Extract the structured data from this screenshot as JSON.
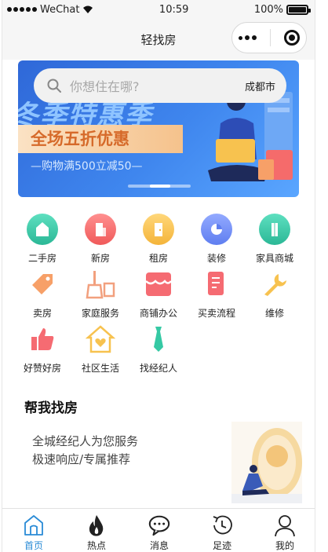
{
  "status_bar": {
    "carrier": "WeChat",
    "time": "10:59",
    "battery": "100%"
  },
  "nav": {
    "title": "轻找房"
  },
  "search": {
    "placeholder": "你想住在哪?",
    "city": "成都市"
  },
  "banner": {
    "headline": "冬季特惠季",
    "promo": "全场五折优惠",
    "sub": "—购物满500立减50—"
  },
  "menu": {
    "rows": [
      [
        {
          "label": "二手房",
          "icon": "house-icon",
          "color": "#3ac9a8"
        },
        {
          "label": "新房",
          "icon": "building-icon",
          "color": "#f56b6b"
        },
        {
          "label": "租房",
          "icon": "door-icon",
          "color": "#f7c24f"
        },
        {
          "label": "装修",
          "icon": "pie-icon",
          "color": "#6f8cf2"
        },
        {
          "label": "家具商城",
          "icon": "furniture-icon",
          "color": "#35c9a4"
        }
      ],
      [
        {
          "label": "卖房",
          "icon": "tag-icon",
          "color": "#f7a068"
        },
        {
          "label": "家庭服务",
          "icon": "broom-icon",
          "color": "#f2a07e"
        },
        {
          "label": "商铺办公",
          "icon": "shop-icon",
          "color": "#f56b72"
        },
        {
          "label": "买卖流程",
          "icon": "document-icon",
          "color": "#f56b72"
        },
        {
          "label": "维修",
          "icon": "wrench-icon",
          "color": "#f7c24f"
        }
      ],
      [
        {
          "label": "好赞好房",
          "icon": "thumbs-up-icon",
          "color": "#f56b72"
        },
        {
          "label": "社区生活",
          "icon": "home-heart-icon",
          "color": "#f7c24f"
        },
        {
          "label": "找经纪人",
          "icon": "tie-icon",
          "color": "#35c9a4"
        }
      ]
    ]
  },
  "help": {
    "title": "帮我找房",
    "line1": "全城经纪人为您服务",
    "line2": "极速响应/专属推荐"
  },
  "tabbar": {
    "items": [
      {
        "label": "首页",
        "icon": "home-icon",
        "active": true
      },
      {
        "label": "热点",
        "icon": "flame-icon",
        "active": false
      },
      {
        "label": "消息",
        "icon": "chat-bubble-icon",
        "active": false
      },
      {
        "label": "足迹",
        "icon": "history-clock-icon",
        "active": false
      },
      {
        "label": "我的",
        "icon": "user-icon",
        "active": false
      }
    ]
  },
  "colors": {
    "accent": "#2a8bd6",
    "banner": "#3f86ee"
  }
}
